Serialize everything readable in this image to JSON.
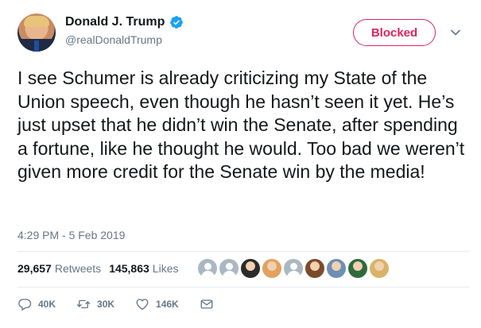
{
  "author": {
    "display_name": "Donald J. Trump",
    "handle": "@realDonaldTrump",
    "verified_color": "#1da1f2"
  },
  "follow_button": {
    "label": "Blocked",
    "color": "#e0245e"
  },
  "tweet": {
    "text": "I see Schumer is already criticizing my State of the Union speech, even though he hasn’t seen it yet. He’s just upset that he didn’t win the Senate, after spending a fortune, like he thought he would. Too bad we weren’t given more credit for the Senate win by the media!",
    "timestamp": "4:29 PM - 5 Feb 2019"
  },
  "stats": {
    "retweets_count": "29,657",
    "retweets_label": "Retweets",
    "likes_count": "145,863",
    "likes_label": "Likes"
  },
  "actions": {
    "reply_count": "40K",
    "retweet_count": "30K",
    "like_count": "146K"
  },
  "likers": [
    {
      "kind": "default-egg",
      "color": "#aab8c2"
    },
    {
      "kind": "default-egg",
      "color": "#aab8c2"
    },
    {
      "kind": "photo",
      "color": "#2b2b2b"
    },
    {
      "kind": "photo",
      "color": "#e3a15f"
    },
    {
      "kind": "default-egg",
      "color": "#aab8c2"
    },
    {
      "kind": "photo",
      "color": "#7a4b2b"
    },
    {
      "kind": "photo",
      "color": "#6d8fb3"
    },
    {
      "kind": "photo",
      "color": "#2f6b3a"
    },
    {
      "kind": "photo",
      "color": "#d9b36a"
    }
  ]
}
